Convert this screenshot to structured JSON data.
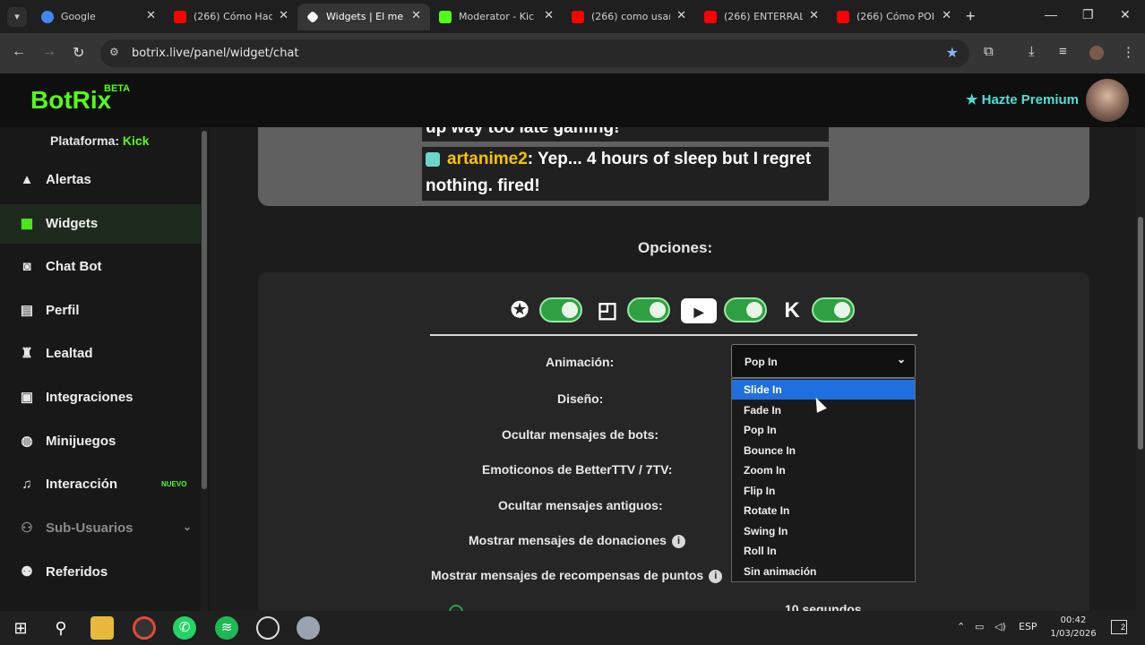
{
  "browser": {
    "tabs": [
      {
        "title": "Google",
        "favicon_color": "#4285f4"
      },
      {
        "title": "(266) Cómo Hac",
        "favicon_color": "#ff0000"
      },
      {
        "title": "Widgets | El me",
        "favicon_color": "#ffffff",
        "active": true
      },
      {
        "title": "Moderator - Kic",
        "favicon_color": "#53fc18"
      },
      {
        "title": "(266) como usar",
        "favicon_color": "#ff0000"
      },
      {
        "title": "(266) ENTERRAL",
        "favicon_color": "#ff0000"
      },
      {
        "title": "(266) Cómo POI",
        "favicon_color": "#ff0000"
      }
    ],
    "url": "botrix.live/panel/widget/chat"
  },
  "header": {
    "logo": "BotRix",
    "beta": "BETA",
    "premium": "Hazte Premium"
  },
  "sidebar": {
    "platform_label": "Plataforma:",
    "platform_value": "Kick",
    "items": [
      {
        "label": "Alertas",
        "icon": "warning-icon"
      },
      {
        "label": "Widgets",
        "icon": "grid-icon",
        "active": true
      },
      {
        "label": "Chat Bot",
        "icon": "robot-icon"
      },
      {
        "label": "Perfil",
        "icon": "id-card-icon"
      },
      {
        "label": "Lealtad",
        "icon": "trophy-icon"
      },
      {
        "label": "Integraciones",
        "icon": "plug-icon"
      },
      {
        "label": "Minijuegos",
        "icon": "gamepad-icon"
      },
      {
        "label": "Interacción",
        "icon": "music-icon",
        "badge": "NUEVO"
      },
      {
        "label": "Sub-Usuarios",
        "icon": "users-icon",
        "muted": true
      },
      {
        "label": "Referidos",
        "icon": "people-icon"
      }
    ]
  },
  "preview": {
    "msg1_tail": "up way too late gaming!",
    "msg2_user": "artanime2",
    "msg2_text_line1": ": Yep... 4 hours of sleep but I regret",
    "msg2_text_line2": "nothing. fired!"
  },
  "options": {
    "title": "Opciones:",
    "labels": {
      "animacion": "Animación:",
      "diseno": "Diseño:",
      "ocultar_bots": "Ocultar mensajes de bots:",
      "emoticonos": "Emoticonos de BetterTTV / 7TV:",
      "ocultar_antiguos": "Ocultar mensajes antiguos:",
      "donaciones": "Mostrar mensajes de donaciones",
      "recompensas": "Mostrar mensajes de recompensas de puntos"
    },
    "animation_selected": "Pop In",
    "animation_options": [
      "Slide In",
      "Fade In",
      "Pop In",
      "Bounce In",
      "Zoom In",
      "Flip In",
      "Rotate In",
      "Swing In",
      "Roll In",
      "Sin animación"
    ],
    "highlighted_option": "Slide In",
    "partial_value": "10 segundos",
    "platform_toggles": [
      {
        "platform": "Kick",
        "on": true
      },
      {
        "platform": "Twitch",
        "on": true
      },
      {
        "platform": "YouTube",
        "on": true
      },
      {
        "platform": "Kick",
        "on": true
      }
    ]
  },
  "taskbar": {
    "lang": "ESP",
    "time": "00:42",
    "date": "1/03/2026",
    "notifications": "2"
  },
  "colors": {
    "accent_green": "#53fc18",
    "premium_teal": "#4fe0d3",
    "toggle_green": "#2ea043",
    "highlight_blue": "#1f6fe0"
  }
}
